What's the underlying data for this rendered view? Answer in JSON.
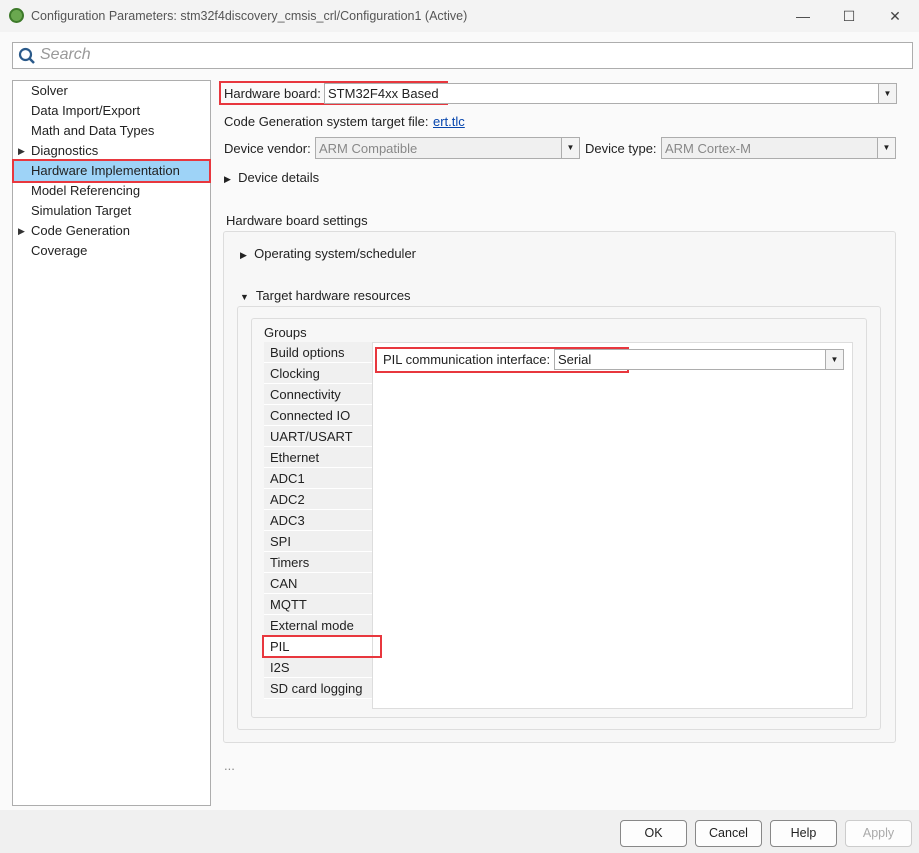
{
  "window": {
    "title": "Configuration Parameters: stm32f4discovery_cmsis_crl/Configuration1 (Active)",
    "minimize": "—",
    "maximize": "☐",
    "close": "✕"
  },
  "search": {
    "placeholder": "Search"
  },
  "tree": [
    {
      "label": "Solver",
      "expandable": false
    },
    {
      "label": "Data Import/Export",
      "expandable": false
    },
    {
      "label": "Math and Data Types",
      "expandable": false
    },
    {
      "label": "Diagnostics",
      "expandable": true
    },
    {
      "label": "Hardware Implementation",
      "expandable": false,
      "selected": true
    },
    {
      "label": "Model Referencing",
      "expandable": false
    },
    {
      "label": "Simulation Target",
      "expandable": false
    },
    {
      "label": "Code Generation",
      "expandable": true
    },
    {
      "label": "Coverage",
      "expandable": false
    }
  ],
  "hw": {
    "board_label": "Hardware board:",
    "board_value": "STM32F4xx Based",
    "target_file_label": "Code Generation system target file:",
    "target_file_link": "ert.tlc",
    "vendor_label": "Device vendor:",
    "vendor_value": "ARM Compatible",
    "type_label": "Device type:",
    "type_value": "ARM Cortex-M",
    "device_details": "Device details",
    "board_settings": "Hardware board settings",
    "os_scheduler": "Operating system/scheduler",
    "target_resources": "Target hardware resources",
    "groups_label": "Groups",
    "groups": [
      "Build options",
      "Clocking",
      "Connectivity",
      "Connected IO",
      "UART/USART",
      "Ethernet",
      "ADC1",
      "ADC2",
      "ADC3",
      "SPI",
      "Timers",
      "CAN",
      "MQTT",
      "External mode",
      "PIL",
      "I2S",
      "SD card logging"
    ],
    "selected_group": "PIL",
    "pil_label": "PIL communication interface:",
    "pil_value": "Serial",
    "ellipsis": "..."
  },
  "buttons": {
    "ok": "OK",
    "cancel": "Cancel",
    "help": "Help",
    "apply": "Apply"
  }
}
